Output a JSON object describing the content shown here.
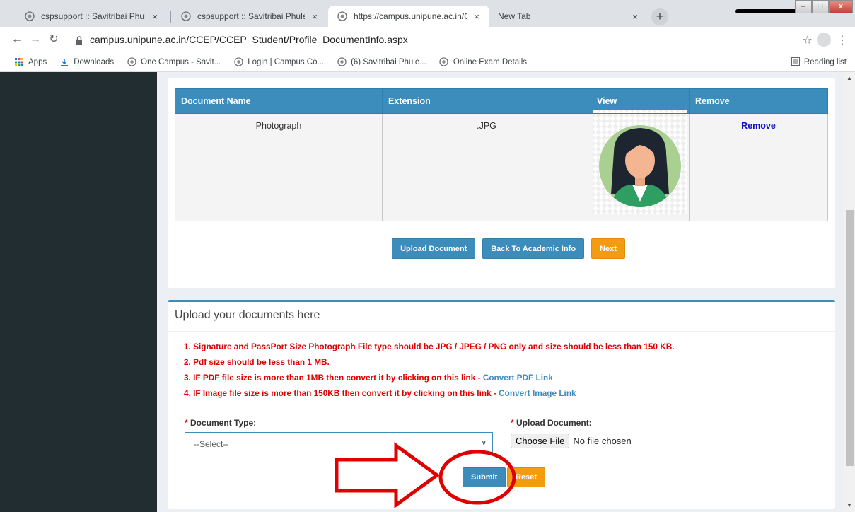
{
  "browser": {
    "tabs": [
      {
        "title": "cspsupport :: Savitribai Phule Pun",
        "active": false
      },
      {
        "title": "cspsupport :: Savitribai Phule Pun",
        "active": false
      },
      {
        "title": "https://campus.unipune.ac.in/CC",
        "active": true
      },
      {
        "title": "New Tab",
        "active": false
      }
    ],
    "new_tab_symbol": "+",
    "close_symbol": "×",
    "url": "campus.unipune.ac.in/CCEP/CCEP_Student/Profile_DocumentInfo.aspx",
    "bookmarks": [
      {
        "label": "Apps",
        "icon": "apps-grid-icon"
      },
      {
        "label": "Downloads",
        "icon": "download-icon"
      },
      {
        "label": "One Campus - Savit...",
        "icon": "university-seal-icon"
      },
      {
        "label": "Login | Campus Co...",
        "icon": "university-seal-icon"
      },
      {
        "label": "(6) Savitribai Phule...",
        "icon": "university-seal-icon"
      },
      {
        "label": "Online Exam Details",
        "icon": "university-seal-icon"
      }
    ],
    "reading_list": "Reading list"
  },
  "documents_table": {
    "headers": [
      "Document Name",
      "Extension",
      "View",
      "Remove"
    ],
    "rows": [
      {
        "name": "Photograph",
        "extension": ".JPG",
        "remove": "Remove"
      }
    ]
  },
  "actions": {
    "upload": "Upload Document",
    "back": "Back To Academic Info",
    "next": "Next"
  },
  "upload_section": {
    "title": "Upload your documents here",
    "instructions": [
      {
        "text": "1. Signature and PassPort Size Photograph File type should be JPG / JPEG / PNG only and size should be less than 150 KB.",
        "link": ""
      },
      {
        "text": "2. Pdf size should be less than 1 MB.",
        "link": ""
      },
      {
        "text": "3. IF PDF file size is more than 1MB then convert it by clicking on this link - ",
        "link": "Convert PDF Link"
      },
      {
        "text": "4. IF Image file size is more than 150KB then convert it by clicking on this link - ",
        "link": "Convert Image Link"
      }
    ],
    "doc_type_label": "Document Type:",
    "doc_type_selected": "--Select--",
    "upload_label": "Upload Document:",
    "required_mark": "*",
    "choose_file": "Choose File",
    "no_file": "No file chosen",
    "submit": "Submit",
    "reset": "Reset"
  },
  "colors": {
    "primary": "#3c8dbc",
    "warning": "#f39c12",
    "annotation": "#e00000",
    "sidebar": "#222d32"
  }
}
